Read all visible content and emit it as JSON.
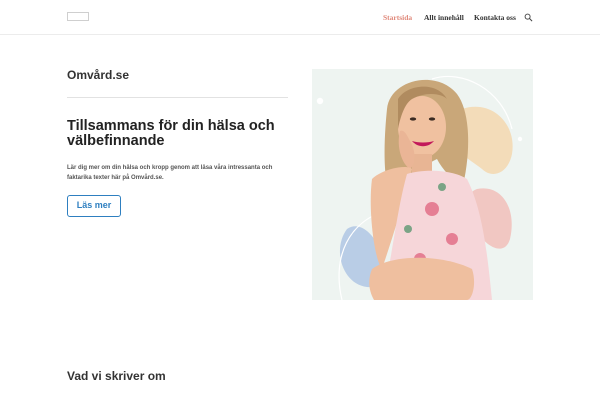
{
  "nav": {
    "items": [
      "Startsida",
      "Allt innehåll",
      "Kontakta oss"
    ],
    "active_color": "#e0897b"
  },
  "hero": {
    "site_name": "Omvård.se",
    "title": "Tillsammans för din hälsa och välbefinnande",
    "text": "Lär dig mer om din hälsa och kropp genom att läsa våra intressanta och faktarika texter här på Omvård.se.",
    "button_label": "Läs mer",
    "button_color": "#2e7fc0"
  },
  "section": {
    "heading": "Vad vi skriver om"
  }
}
